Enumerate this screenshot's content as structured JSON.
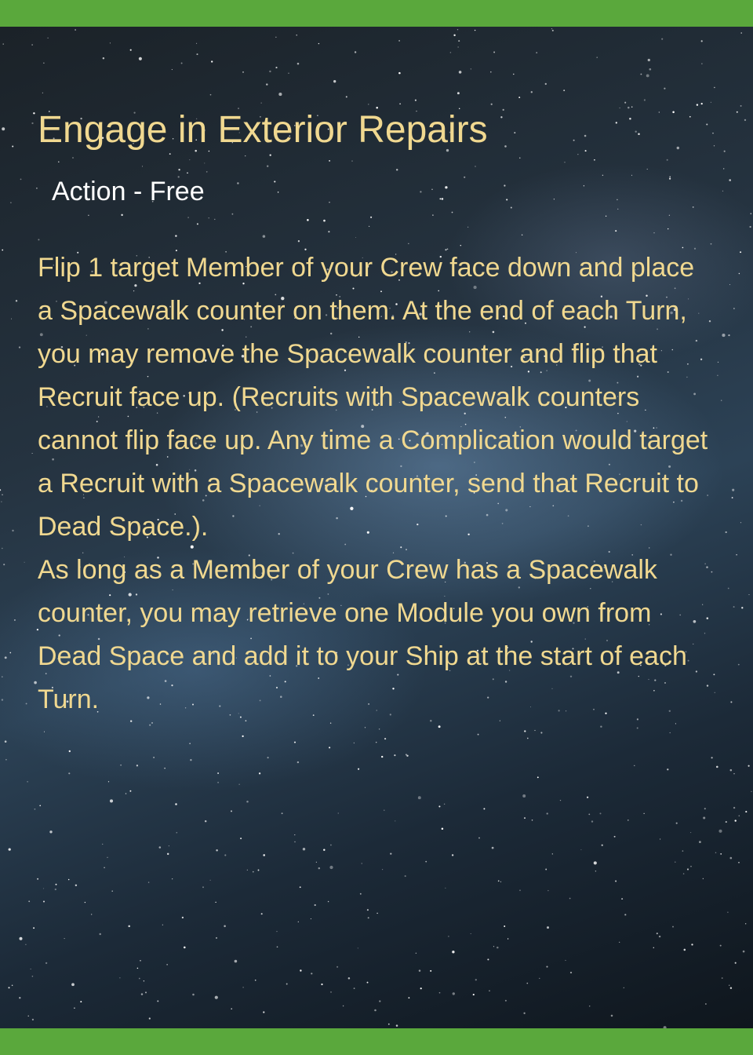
{
  "card": {
    "title": "Engage in Exterior Repairs",
    "type_line": "Action - Free",
    "paragraphs": [
      "Flip 1 target Member of your Crew face down and place a Spacewalk counter on them. At the end of each Turn, you may remove the Spacewalk counter and flip that Recruit face up. (Recruits with Spacewalk counters cannot flip face up. Any time a Complication would target a Recruit with a Spacewalk counter, send that Recruit to Dead Space.).",
      "As long as a Member of your Crew has a Spacewalk counter, you may retrieve one Module you own from Dead Space and add it to your Ship at the start of each Turn."
    ]
  },
  "colors": {
    "border_band": "#5aa83c",
    "title_text": "#f0d890",
    "type_text": "#ffffff",
    "body_text": "#f0d890"
  }
}
